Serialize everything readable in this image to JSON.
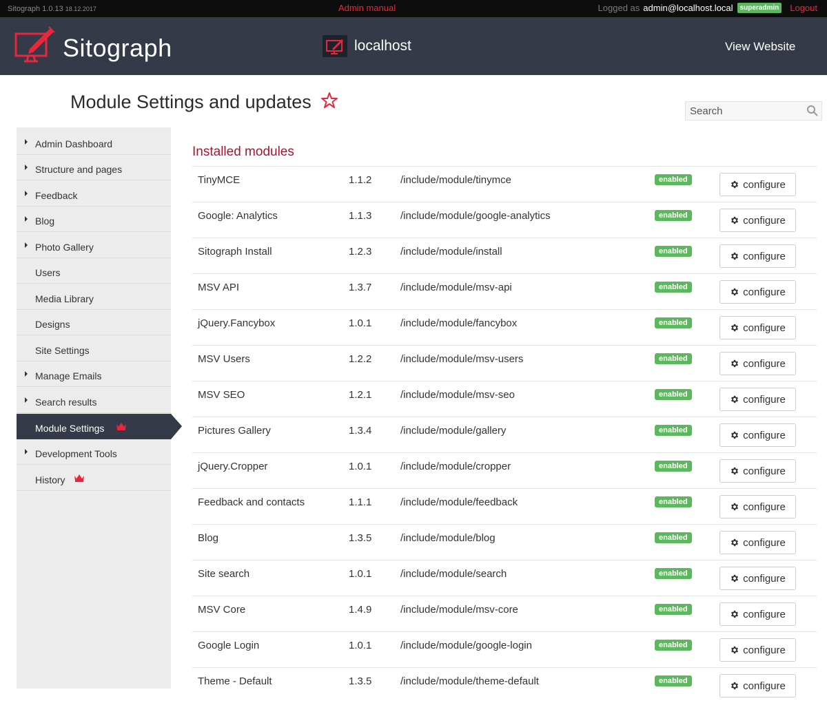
{
  "topbar": {
    "app_version": "Sitograph 1.0.13",
    "release_date": "18.12.2017",
    "admin_manual": "Admin manual",
    "logged_as_label": "Logged as",
    "user_email": "admin@localhost.local",
    "role_badge": "superadmin",
    "logout": "Logout"
  },
  "header": {
    "brand": "Sitograph",
    "site_name": "localhost",
    "view_website": "View Website"
  },
  "page": {
    "title": "Module Settings and updates",
    "search_placeholder": "Search"
  },
  "sidebar": {
    "items": [
      {
        "label": "Admin Dashboard",
        "has_children": true
      },
      {
        "label": "Structure and pages",
        "has_children": true
      },
      {
        "label": "Feedback",
        "has_children": true
      },
      {
        "label": "Blog",
        "has_children": true
      },
      {
        "label": "Photo Gallery",
        "has_children": true
      },
      {
        "label": "Users",
        "has_children": false
      },
      {
        "label": "Media Library",
        "has_children": false
      },
      {
        "label": "Designs",
        "has_children": false
      },
      {
        "label": "Site Settings",
        "has_children": false
      },
      {
        "label": "Manage Emails",
        "has_children": true
      },
      {
        "label": "Search results",
        "has_children": true
      },
      {
        "label": "Module Settings",
        "has_children": false,
        "active": true,
        "crown": true
      },
      {
        "label": "Development Tools",
        "has_children": true
      },
      {
        "label": "History",
        "has_children": false,
        "crown": true
      }
    ]
  },
  "main": {
    "section_title": "Installed modules",
    "configure_label": "configure",
    "modules": [
      {
        "name": "TinyMCE",
        "version": "1.1.2",
        "path": "/include/module/tinymce",
        "status": "enabled"
      },
      {
        "name": "Google: Analytics",
        "version": "1.1.3",
        "path": "/include/module/google-analytics",
        "status": "enabled"
      },
      {
        "name": "Sitograph Install",
        "version": "1.2.3",
        "path": "/include/module/install",
        "status": "enabled"
      },
      {
        "name": "MSV API",
        "version": "1.3.7",
        "path": "/include/module/msv-api",
        "status": "enabled"
      },
      {
        "name": "jQuery.Fancybox",
        "version": "1.0.1",
        "path": "/include/module/fancybox",
        "status": "enabled"
      },
      {
        "name": "MSV Users",
        "version": "1.2.2",
        "path": "/include/module/msv-users",
        "status": "enabled"
      },
      {
        "name": "MSV SEO",
        "version": "1.2.1",
        "path": "/include/module/msv-seo",
        "status": "enabled"
      },
      {
        "name": "Pictures Gallery",
        "version": "1.3.4",
        "path": "/include/module/gallery",
        "status": "enabled"
      },
      {
        "name": "jQuery.Cropper",
        "version": "1.0.1",
        "path": "/include/module/cropper",
        "status": "enabled"
      },
      {
        "name": "Feedback and contacts",
        "version": "1.1.1",
        "path": "/include/module/feedback",
        "status": "enabled"
      },
      {
        "name": "Blog",
        "version": "1.3.5",
        "path": "/include/module/blog",
        "status": "enabled"
      },
      {
        "name": "Site search",
        "version": "1.0.1",
        "path": "/include/module/search",
        "status": "enabled"
      },
      {
        "name": "MSV Core",
        "version": "1.4.9",
        "path": "/include/module/msv-core",
        "status": "enabled"
      },
      {
        "name": "Google Login",
        "version": "1.0.1",
        "path": "/include/module/google-login",
        "status": "enabled"
      },
      {
        "name": "Theme - Default",
        "version": "1.3.5",
        "path": "/include/module/theme-default",
        "status": "enabled"
      }
    ]
  },
  "colors": {
    "header_bg": "#343a48",
    "accent_red": "#e8273d",
    "section_title": "#a3182f",
    "enabled_badge": "#5cb85c",
    "sidebar_bg": "#ececec"
  },
  "icons": {
    "logo": "monitor-with-pen-icon",
    "site": "monitor-icon",
    "favorite": "star-outline-icon",
    "search": "search-icon",
    "crown": "crown-icon",
    "gear": "gear-icon",
    "arrow": "caret-right-icon"
  }
}
